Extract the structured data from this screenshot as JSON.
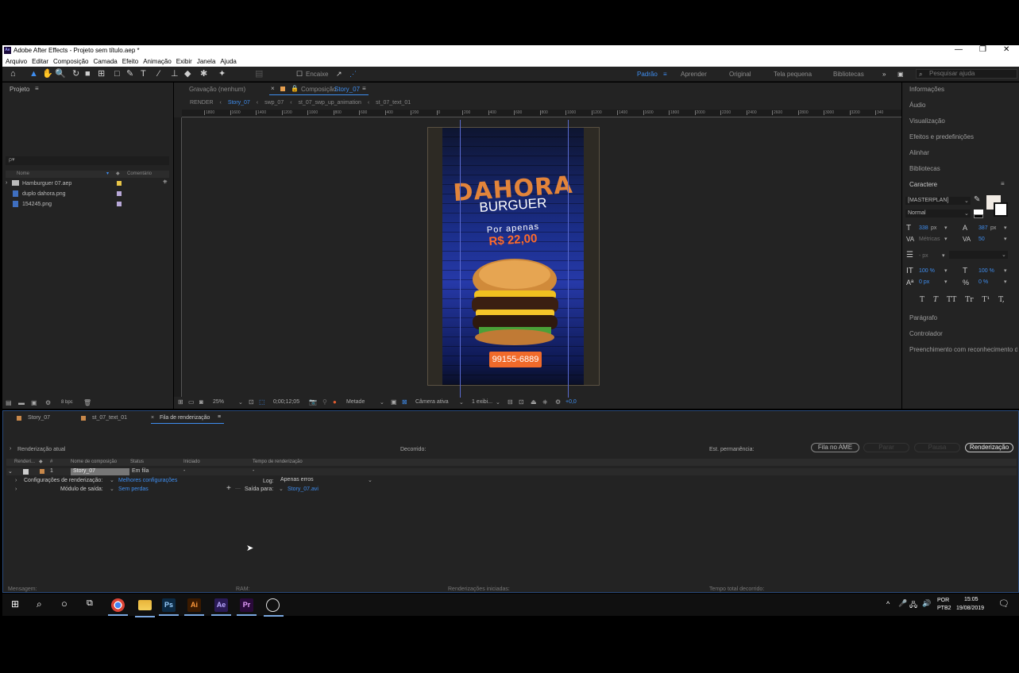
{
  "window": {
    "title": "Adobe After Effects - Projeto sem título.aep *",
    "app_icon": "Ae",
    "controls": [
      "—",
      "❐",
      "✕"
    ]
  },
  "menu": [
    "Arquivo",
    "Editar",
    "Composição",
    "Camada",
    "Efeito",
    "Animação",
    "Exibir",
    "Janela",
    "Ajuda"
  ],
  "toolbar": {
    "snap_label": "Encaixe",
    "workspaces": [
      "Padrão",
      "Aprender",
      "Original",
      "Tela pequena",
      "Bibliotecas"
    ],
    "search_placeholder": "Pesquisar ajuda"
  },
  "project": {
    "title": "Projeto",
    "search_placeholder": "ρ▾",
    "columns": [
      "Nome",
      "Comentário"
    ],
    "items": [
      {
        "name": "Hamburguer 07.aep",
        "type": "folder",
        "color": "#e8c547"
      },
      {
        "name": "duplo dahora.png",
        "type": "image",
        "color": "#b8a8d8"
      },
      {
        "name": "154245.png",
        "type": "image",
        "color": "#b8a8d8"
      }
    ],
    "bpc": "8 bpc"
  },
  "composition": {
    "tab_footage": "Gravação (nenhum)",
    "tab_comp_prefix": "Composição",
    "tab_comp_name": "Story_07",
    "breadcrumbs": [
      "RENDER",
      "Story_07",
      "swp_07",
      "st_07_swp_up_animation",
      "st_07_text_01"
    ],
    "ruler_ticks": [
      "1800",
      "1600",
      "1400",
      "1200",
      "1000",
      "800",
      "600",
      "400",
      "200",
      "0",
      "200",
      "400",
      "600",
      "800",
      "1000",
      "1200",
      "1400",
      "1600",
      "1800",
      "2000",
      "2200",
      "2400",
      "2600",
      "2800",
      "3000",
      "3200",
      "340"
    ],
    "artwork": {
      "title_main": "DAHORA",
      "title_sub": "BURGUER",
      "promo_line": "Por apenas",
      "price": "R$ 22,00",
      "phone": "99155-6889"
    },
    "footer": {
      "zoom": "25%",
      "timecode": "0;00;12;05",
      "resolution": "Metade",
      "camera": "Câmera ativa",
      "views": "1 exibi...",
      "exposure": "+0,0"
    }
  },
  "right_panel": {
    "items": [
      "Informações",
      "Áudio",
      "Visualização",
      "Efeitos e predefinições",
      "Alinhar",
      "Bibliotecas"
    ],
    "character": {
      "title": "Caractere",
      "font": "[MASTERPLAN]",
      "style": "Normal",
      "size": "338",
      "size_unit": "px",
      "leading": "387",
      "leading_unit": "px",
      "kerning": "Métricas",
      "tracking": "50",
      "stroke": "- px",
      "vscale": "100 %",
      "hscale": "100 %",
      "baseline": "0 px",
      "tsume": "0 %",
      "styles": [
        "T",
        "T",
        "TT",
        "Tr",
        "T¹",
        "T,"
      ]
    },
    "bottom_items": [
      "Parágrafo",
      "Controlador",
      "Preenchimento com reconhecimento d"
    ]
  },
  "render_queue": {
    "tabs": [
      "Story_07",
      "st_07_text_01",
      "Fila de renderização"
    ],
    "current_label": "Renderização atual",
    "elapsed_label": "Decorrido:",
    "est_label": "Est. permanência:",
    "buttons": [
      "Fila no AME",
      "Parar",
      "Pausa",
      "Renderização"
    ],
    "columns": [
      "Renderi...",
      "#",
      "Nome de composição",
      "Status",
      "Iniciado",
      "Tempo de renderização"
    ],
    "item": {
      "number": "1",
      "name": "Story_07",
      "status": "Em fila",
      "started": "-",
      "render_time": "-"
    },
    "settings_label": "Configurações de renderização:",
    "settings_value": "Melhores configurações",
    "log_label": "Log:",
    "log_value": "Apenas erros",
    "output_module_label": "Módulo de saída:",
    "output_module_value": "Sem perdas",
    "output_to_label": "Saída para:",
    "output_to_value": "Story_07.avi",
    "status_bar": [
      "Mensagem:",
      "RAM:",
      "Renderizações iniciadas:",
      "Tempo total decorrido:"
    ]
  },
  "taskbar": {
    "apps": [
      {
        "label": "",
        "name": "chrome-icon",
        "bg": "#f4b400"
      },
      {
        "label": "",
        "name": "folder-icon",
        "bg": "#f0c040"
      },
      {
        "label": "Ps",
        "name": "photoshop-icon",
        "bg": "#0c2a44"
      },
      {
        "label": "Ai",
        "name": "illustrator-icon",
        "bg": "#3a1a00"
      },
      {
        "label": "Ae",
        "name": "after-effects-icon",
        "bg": "#2a1a55"
      },
      {
        "label": "Pr",
        "name": "premiere-icon",
        "bg": "#2a0a3a"
      },
      {
        "label": "",
        "name": "app-icon",
        "bg": "#101010"
      }
    ],
    "lang": "POR",
    "layout": "PTB2",
    "time": "15:05",
    "date": "19/08/2019"
  }
}
